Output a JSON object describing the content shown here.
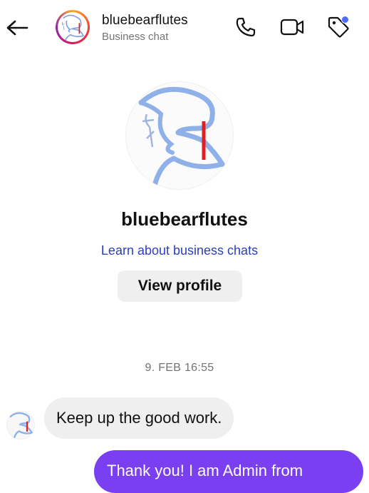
{
  "header": {
    "back_icon": "arrow-left-icon",
    "name": "bluebearflutes",
    "subtitle": "Business chat",
    "icons": [
      "phone-icon",
      "video-camera-icon",
      "tag-icon"
    ],
    "tag_badge_color": "#4d6bfe"
  },
  "profile": {
    "name": "bluebearflutes",
    "learn_link": "Learn about business chats",
    "view_profile_label": "View profile"
  },
  "conversation": {
    "timestamp": "9. FEB 16:55",
    "messages": [
      {
        "direction": "incoming",
        "text": "Keep up the good work."
      },
      {
        "direction": "outgoing",
        "text": "Thank you! I am Admin from"
      }
    ]
  },
  "colors": {
    "link": "#2b3fc0",
    "outgoing_bubble": "#7b3ff2",
    "incoming_bubble": "#efefef",
    "secondary_text": "#737373"
  }
}
